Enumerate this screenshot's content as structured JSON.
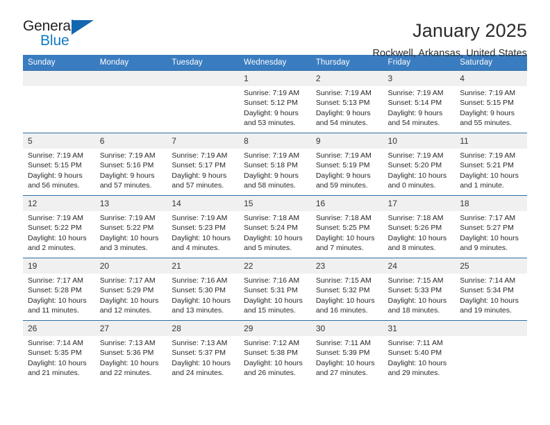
{
  "brand": {
    "name_part1": "General",
    "name_part2": "Blue",
    "triangle_icon": "triangle-icon"
  },
  "header": {
    "title": "January 2025",
    "subtitle": "Rockwell, Arkansas, United States"
  },
  "colors": {
    "header_blue": "#3a7cc0",
    "row_border_blue": "#2e6da4",
    "daynum_bg": "#f0f0f0",
    "brand_blue": "#1279c5",
    "text": "#272727"
  },
  "calendar": {
    "weekday_headers": [
      "Sunday",
      "Monday",
      "Tuesday",
      "Wednesday",
      "Thursday",
      "Friday",
      "Saturday"
    ],
    "weeks": [
      [
        {
          "day": "",
          "sunrise": "",
          "sunset": "",
          "daylight_line1": "",
          "daylight_line2": ""
        },
        {
          "day": "",
          "sunrise": "",
          "sunset": "",
          "daylight_line1": "",
          "daylight_line2": ""
        },
        {
          "day": "",
          "sunrise": "",
          "sunset": "",
          "daylight_line1": "",
          "daylight_line2": ""
        },
        {
          "day": "1",
          "sunrise": "Sunrise: 7:19 AM",
          "sunset": "Sunset: 5:12 PM",
          "daylight_line1": "Daylight: 9 hours",
          "daylight_line2": "and 53 minutes."
        },
        {
          "day": "2",
          "sunrise": "Sunrise: 7:19 AM",
          "sunset": "Sunset: 5:13 PM",
          "daylight_line1": "Daylight: 9 hours",
          "daylight_line2": "and 54 minutes."
        },
        {
          "day": "3",
          "sunrise": "Sunrise: 7:19 AM",
          "sunset": "Sunset: 5:14 PM",
          "daylight_line1": "Daylight: 9 hours",
          "daylight_line2": "and 54 minutes."
        },
        {
          "day": "4",
          "sunrise": "Sunrise: 7:19 AM",
          "sunset": "Sunset: 5:15 PM",
          "daylight_line1": "Daylight: 9 hours",
          "daylight_line2": "and 55 minutes."
        }
      ],
      [
        {
          "day": "5",
          "sunrise": "Sunrise: 7:19 AM",
          "sunset": "Sunset: 5:15 PM",
          "daylight_line1": "Daylight: 9 hours",
          "daylight_line2": "and 56 minutes."
        },
        {
          "day": "6",
          "sunrise": "Sunrise: 7:19 AM",
          "sunset": "Sunset: 5:16 PM",
          "daylight_line1": "Daylight: 9 hours",
          "daylight_line2": "and 57 minutes."
        },
        {
          "day": "7",
          "sunrise": "Sunrise: 7:19 AM",
          "sunset": "Sunset: 5:17 PM",
          "daylight_line1": "Daylight: 9 hours",
          "daylight_line2": "and 57 minutes."
        },
        {
          "day": "8",
          "sunrise": "Sunrise: 7:19 AM",
          "sunset": "Sunset: 5:18 PM",
          "daylight_line1": "Daylight: 9 hours",
          "daylight_line2": "and 58 minutes."
        },
        {
          "day": "9",
          "sunrise": "Sunrise: 7:19 AM",
          "sunset": "Sunset: 5:19 PM",
          "daylight_line1": "Daylight: 9 hours",
          "daylight_line2": "and 59 minutes."
        },
        {
          "day": "10",
          "sunrise": "Sunrise: 7:19 AM",
          "sunset": "Sunset: 5:20 PM",
          "daylight_line1": "Daylight: 10 hours",
          "daylight_line2": "and 0 minutes."
        },
        {
          "day": "11",
          "sunrise": "Sunrise: 7:19 AM",
          "sunset": "Sunset: 5:21 PM",
          "daylight_line1": "Daylight: 10 hours",
          "daylight_line2": "and 1 minute."
        }
      ],
      [
        {
          "day": "12",
          "sunrise": "Sunrise: 7:19 AM",
          "sunset": "Sunset: 5:22 PM",
          "daylight_line1": "Daylight: 10 hours",
          "daylight_line2": "and 2 minutes."
        },
        {
          "day": "13",
          "sunrise": "Sunrise: 7:19 AM",
          "sunset": "Sunset: 5:22 PM",
          "daylight_line1": "Daylight: 10 hours",
          "daylight_line2": "and 3 minutes."
        },
        {
          "day": "14",
          "sunrise": "Sunrise: 7:19 AM",
          "sunset": "Sunset: 5:23 PM",
          "daylight_line1": "Daylight: 10 hours",
          "daylight_line2": "and 4 minutes."
        },
        {
          "day": "15",
          "sunrise": "Sunrise: 7:18 AM",
          "sunset": "Sunset: 5:24 PM",
          "daylight_line1": "Daylight: 10 hours",
          "daylight_line2": "and 5 minutes."
        },
        {
          "day": "16",
          "sunrise": "Sunrise: 7:18 AM",
          "sunset": "Sunset: 5:25 PM",
          "daylight_line1": "Daylight: 10 hours",
          "daylight_line2": "and 7 minutes."
        },
        {
          "day": "17",
          "sunrise": "Sunrise: 7:18 AM",
          "sunset": "Sunset: 5:26 PM",
          "daylight_line1": "Daylight: 10 hours",
          "daylight_line2": "and 8 minutes."
        },
        {
          "day": "18",
          "sunrise": "Sunrise: 7:17 AM",
          "sunset": "Sunset: 5:27 PM",
          "daylight_line1": "Daylight: 10 hours",
          "daylight_line2": "and 9 minutes."
        }
      ],
      [
        {
          "day": "19",
          "sunrise": "Sunrise: 7:17 AM",
          "sunset": "Sunset: 5:28 PM",
          "daylight_line1": "Daylight: 10 hours",
          "daylight_line2": "and 11 minutes."
        },
        {
          "day": "20",
          "sunrise": "Sunrise: 7:17 AM",
          "sunset": "Sunset: 5:29 PM",
          "daylight_line1": "Daylight: 10 hours",
          "daylight_line2": "and 12 minutes."
        },
        {
          "day": "21",
          "sunrise": "Sunrise: 7:16 AM",
          "sunset": "Sunset: 5:30 PM",
          "daylight_line1": "Daylight: 10 hours",
          "daylight_line2": "and 13 minutes."
        },
        {
          "day": "22",
          "sunrise": "Sunrise: 7:16 AM",
          "sunset": "Sunset: 5:31 PM",
          "daylight_line1": "Daylight: 10 hours",
          "daylight_line2": "and 15 minutes."
        },
        {
          "day": "23",
          "sunrise": "Sunrise: 7:15 AM",
          "sunset": "Sunset: 5:32 PM",
          "daylight_line1": "Daylight: 10 hours",
          "daylight_line2": "and 16 minutes."
        },
        {
          "day": "24",
          "sunrise": "Sunrise: 7:15 AM",
          "sunset": "Sunset: 5:33 PM",
          "daylight_line1": "Daylight: 10 hours",
          "daylight_line2": "and 18 minutes."
        },
        {
          "day": "25",
          "sunrise": "Sunrise: 7:14 AM",
          "sunset": "Sunset: 5:34 PM",
          "daylight_line1": "Daylight: 10 hours",
          "daylight_line2": "and 19 minutes."
        }
      ],
      [
        {
          "day": "26",
          "sunrise": "Sunrise: 7:14 AM",
          "sunset": "Sunset: 5:35 PM",
          "daylight_line1": "Daylight: 10 hours",
          "daylight_line2": "and 21 minutes."
        },
        {
          "day": "27",
          "sunrise": "Sunrise: 7:13 AM",
          "sunset": "Sunset: 5:36 PM",
          "daylight_line1": "Daylight: 10 hours",
          "daylight_line2": "and 22 minutes."
        },
        {
          "day": "28",
          "sunrise": "Sunrise: 7:13 AM",
          "sunset": "Sunset: 5:37 PM",
          "daylight_line1": "Daylight: 10 hours",
          "daylight_line2": "and 24 minutes."
        },
        {
          "day": "29",
          "sunrise": "Sunrise: 7:12 AM",
          "sunset": "Sunset: 5:38 PM",
          "daylight_line1": "Daylight: 10 hours",
          "daylight_line2": "and 26 minutes."
        },
        {
          "day": "30",
          "sunrise": "Sunrise: 7:11 AM",
          "sunset": "Sunset: 5:39 PM",
          "daylight_line1": "Daylight: 10 hours",
          "daylight_line2": "and 27 minutes."
        },
        {
          "day": "31",
          "sunrise": "Sunrise: 7:11 AM",
          "sunset": "Sunset: 5:40 PM",
          "daylight_line1": "Daylight: 10 hours",
          "daylight_line2": "and 29 minutes."
        },
        {
          "day": "",
          "sunrise": "",
          "sunset": "",
          "daylight_line1": "",
          "daylight_line2": ""
        }
      ]
    ]
  }
}
